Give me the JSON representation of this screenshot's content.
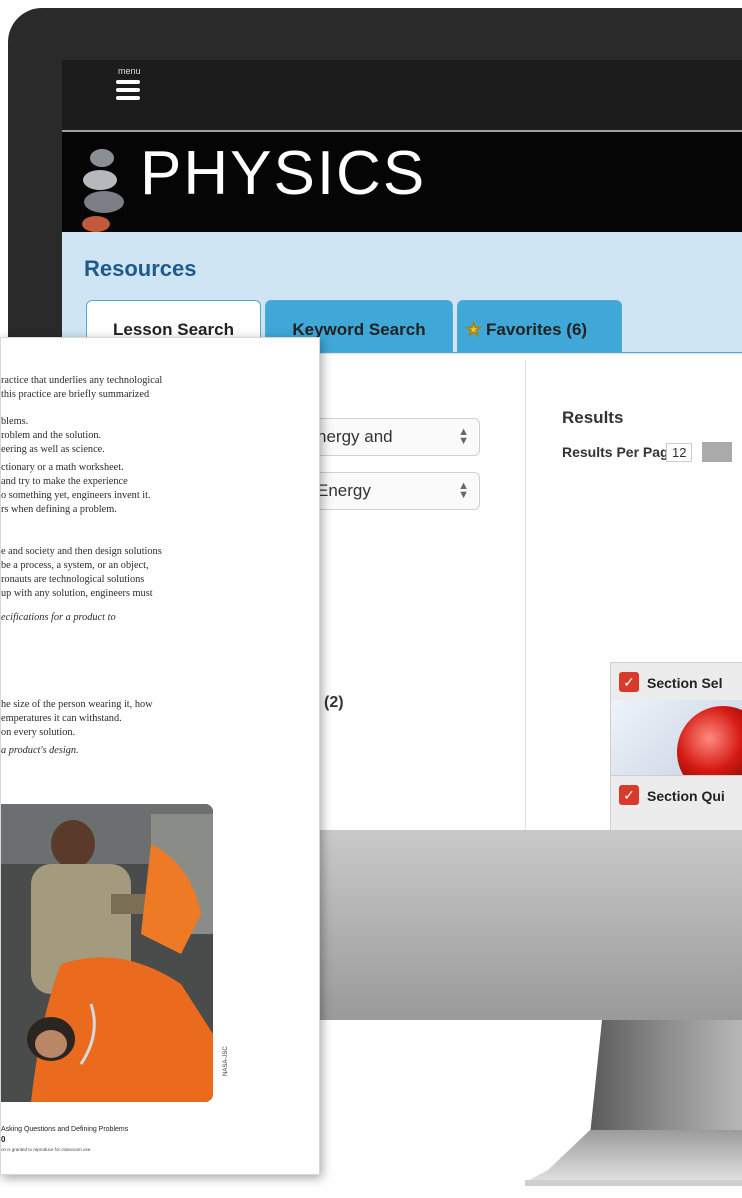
{
  "header": {
    "menu_label": "menu",
    "banner_title": "PHYSICS"
  },
  "resources": {
    "heading": "Resources",
    "tabs": [
      {
        "label": "Lesson Search"
      },
      {
        "label": "Keyword Search"
      },
      {
        "label": "Favorites (6)"
      }
    ],
    "filters": {
      "select_1_value": "nergy and",
      "select_2_value": "Energy",
      "count_label": "(2)"
    }
  },
  "results": {
    "heading": "Results",
    "per_page_label": "Results Per Page",
    "per_page_value": "12",
    "cards": [
      {
        "title": "Section Sel"
      },
      {
        "title": "Section Qui"
      }
    ]
  },
  "document": {
    "lines": [
      "ractice that underlies any technological",
      "this practice are briefly summarized",
      "blems.",
      "roblem and the solution.",
      "eering as well as science.",
      "ctionary or a math worksheet.",
      "and try to make the experience",
      "o something yet, engineers invent it.",
      "rs when defining a problem.",
      "e and society and then design solutions",
      "be a process, a system, or an object,",
      "ronauts are technological solutions",
      "up with any solution, engineers must",
      "ecifications for a product to",
      "he size of the person wearing it, how",
      "emperatures it can withstand.",
      "on every solution.",
      "a product's design."
    ],
    "photo_credit": "NASA-JSC",
    "footer_title": "Asking Questions and Defining Problems",
    "footer_page": "0",
    "footer_copy": "on is granted to reproduce for classroom use."
  },
  "colors": {
    "tab_active": "#ffffff",
    "tab_inactive": "#3fa8d8",
    "resources_bg": "#cfe5f3",
    "heading_blue": "#1f5a8f",
    "check_red": "#d93a2b"
  }
}
